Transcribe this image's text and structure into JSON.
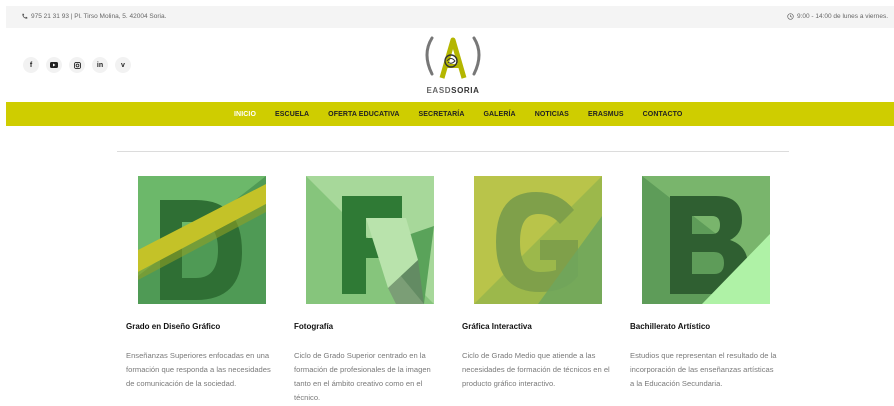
{
  "topbar": {
    "contact": "975 21 31 93 | Pl. Tirso Molina, 5. 42004 Soria.",
    "hours": "9:00 - 14:00 de lunes a viernes.",
    "icons": [
      "phone-icon",
      "clock-icon"
    ]
  },
  "social": [
    {
      "name": "facebook-icon",
      "glyph": "f"
    },
    {
      "name": "youtube-icon",
      "glyph": "▶"
    },
    {
      "name": "instagram-icon",
      "glyph": "◎"
    },
    {
      "name": "linkedin-icon",
      "glyph": "in"
    },
    {
      "name": "vimeo-icon",
      "glyph": "v"
    }
  ],
  "logo": {
    "text_a": "EASD",
    "text_b": "SORIA"
  },
  "colors": {
    "accent": "#cfcd00",
    "logo_green": "#b4b600"
  },
  "nav": {
    "items": [
      "INICIO",
      "ESCUELA",
      "OFERTA EDUCATIVA",
      "SECRETARÍA",
      "GALERÍA",
      "NOTICIAS",
      "ERASMUS",
      "CONTACTO"
    ],
    "active": "INICIO"
  },
  "cards": [
    {
      "title": "Grado en Diseño Gráfico",
      "description": "Enseñanzas Superiores enfocadas en una formación que responda a las necesidades de comunicación de la sociedad."
    },
    {
      "title": "Fotografía",
      "description": "Ciclo de Grado Superior centrado en la formación de profesionales de la imagen tanto en el ámbito creativo como en el técnico."
    },
    {
      "title": "Gráfica Interactiva",
      "description": "Ciclo de Grado Medio que atiende a las necesidades de formación de técnicos en el producto gráfico interactivo."
    },
    {
      "title": "Bachillerato Artístico",
      "description": "Estudios que representan el resultado de la incorporación de las enseñanzas artísticas a la Educación Secundaria."
    }
  ]
}
